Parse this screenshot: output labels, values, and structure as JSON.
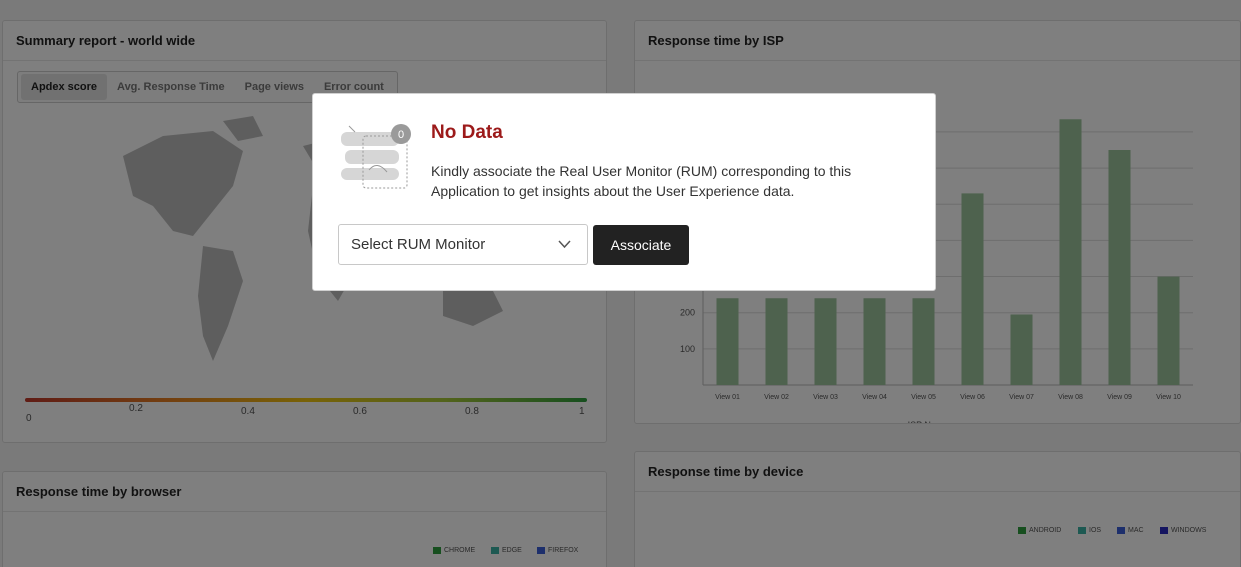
{
  "summary": {
    "title": "Summary report - world wide",
    "tabs": [
      "Apdex score",
      "Avg. Response Time",
      "Page views",
      "Error count"
    ],
    "legend_ticks": [
      "0",
      "0.2",
      "0.4",
      "0.6",
      "0.8",
      "1"
    ]
  },
  "isp": {
    "title": "Response time by ISP",
    "xlabel": "ISP Name"
  },
  "browser": {
    "title": "Response time by browser",
    "legend": [
      {
        "name": "CHROME",
        "color": "#2e9e3e"
      },
      {
        "name": "EDGE",
        "color": "#3bb3a5"
      },
      {
        "name": "FIREFOX",
        "color": "#3a5fd8"
      }
    ]
  },
  "device": {
    "title": "Response time by device",
    "legend": [
      {
        "name": "ANDROID",
        "color": "#2e9e3e"
      },
      {
        "name": "IOS",
        "color": "#3bb3a5"
      },
      {
        "name": "MAC",
        "color": "#3a5fd8"
      },
      {
        "name": "WINDOWS",
        "color": "#2a2ac0"
      }
    ]
  },
  "modal": {
    "badge": "0",
    "title": "No Data",
    "message": "Kindly associate the Real User Monitor (RUM) corresponding to this Application to get insights about the User Experience data.",
    "select_value": "Select RUM Monitor",
    "associate_label": "Associate"
  },
  "chart_data": {
    "type": "bar",
    "categories": [
      "View 01",
      "View 02",
      "View 03",
      "View 04",
      "View 05",
      "View 06",
      "View 07",
      "View 08",
      "View 09",
      "View 10"
    ],
    "values": [
      240,
      240,
      240,
      240,
      240,
      530,
      195,
      735,
      650,
      300
    ],
    "xlabel": "ISP Name",
    "ylabel": "",
    "ylim": [
      0,
      780
    ],
    "yticks": [
      100,
      200
    ],
    "grid": true,
    "color": "#9dc59d"
  }
}
